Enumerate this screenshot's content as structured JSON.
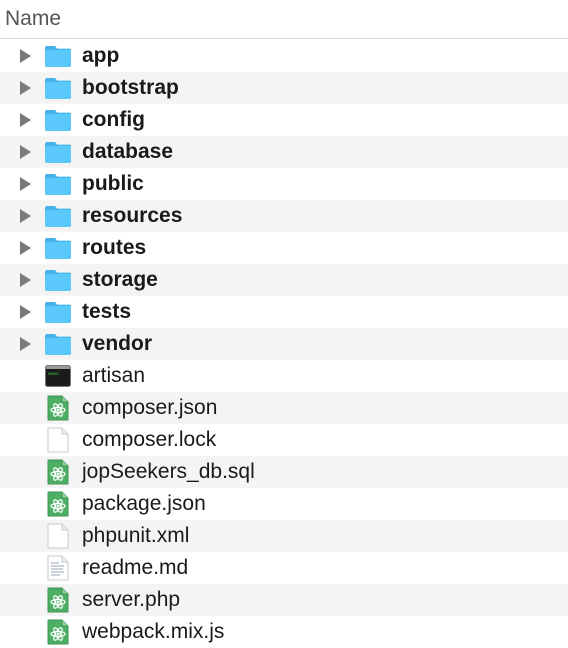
{
  "header": {
    "name_label": "Name"
  },
  "items": [
    {
      "name": "app",
      "kind": "folder",
      "icon": "folder-icon"
    },
    {
      "name": "bootstrap",
      "kind": "folder",
      "icon": "folder-icon"
    },
    {
      "name": "config",
      "kind": "folder",
      "icon": "folder-icon"
    },
    {
      "name": "database",
      "kind": "folder",
      "icon": "folder-icon"
    },
    {
      "name": "public",
      "kind": "folder",
      "icon": "folder-icon"
    },
    {
      "name": "resources",
      "kind": "folder",
      "icon": "folder-icon"
    },
    {
      "name": "routes",
      "kind": "folder",
      "icon": "folder-icon"
    },
    {
      "name": "storage",
      "kind": "folder",
      "icon": "folder-icon"
    },
    {
      "name": "tests",
      "kind": "folder",
      "icon": "folder-icon"
    },
    {
      "name": "vendor",
      "kind": "folder",
      "icon": "folder-icon"
    },
    {
      "name": "artisan",
      "kind": "file",
      "icon": "terminal-executable-icon"
    },
    {
      "name": "composer.json",
      "kind": "file",
      "icon": "atom-document-icon"
    },
    {
      "name": "composer.lock",
      "kind": "file",
      "icon": "blank-document-icon"
    },
    {
      "name": "jopSeekers_db.sql",
      "kind": "file",
      "icon": "atom-document-icon"
    },
    {
      "name": "package.json",
      "kind": "file",
      "icon": "atom-document-icon"
    },
    {
      "name": "phpunit.xml",
      "kind": "file",
      "icon": "blank-document-icon"
    },
    {
      "name": "readme.md",
      "kind": "file",
      "icon": "text-document-icon"
    },
    {
      "name": "server.php",
      "kind": "file",
      "icon": "atom-document-icon"
    },
    {
      "name": "webpack.mix.js",
      "kind": "file",
      "icon": "atom-document-icon"
    }
  ],
  "colors": {
    "folder": "#5ac8fa",
    "folder_dark": "#46b3e8",
    "atom_green": "#4caf63",
    "disclosure": "#7a7a7a",
    "alt_row": "#f4f4f5"
  }
}
